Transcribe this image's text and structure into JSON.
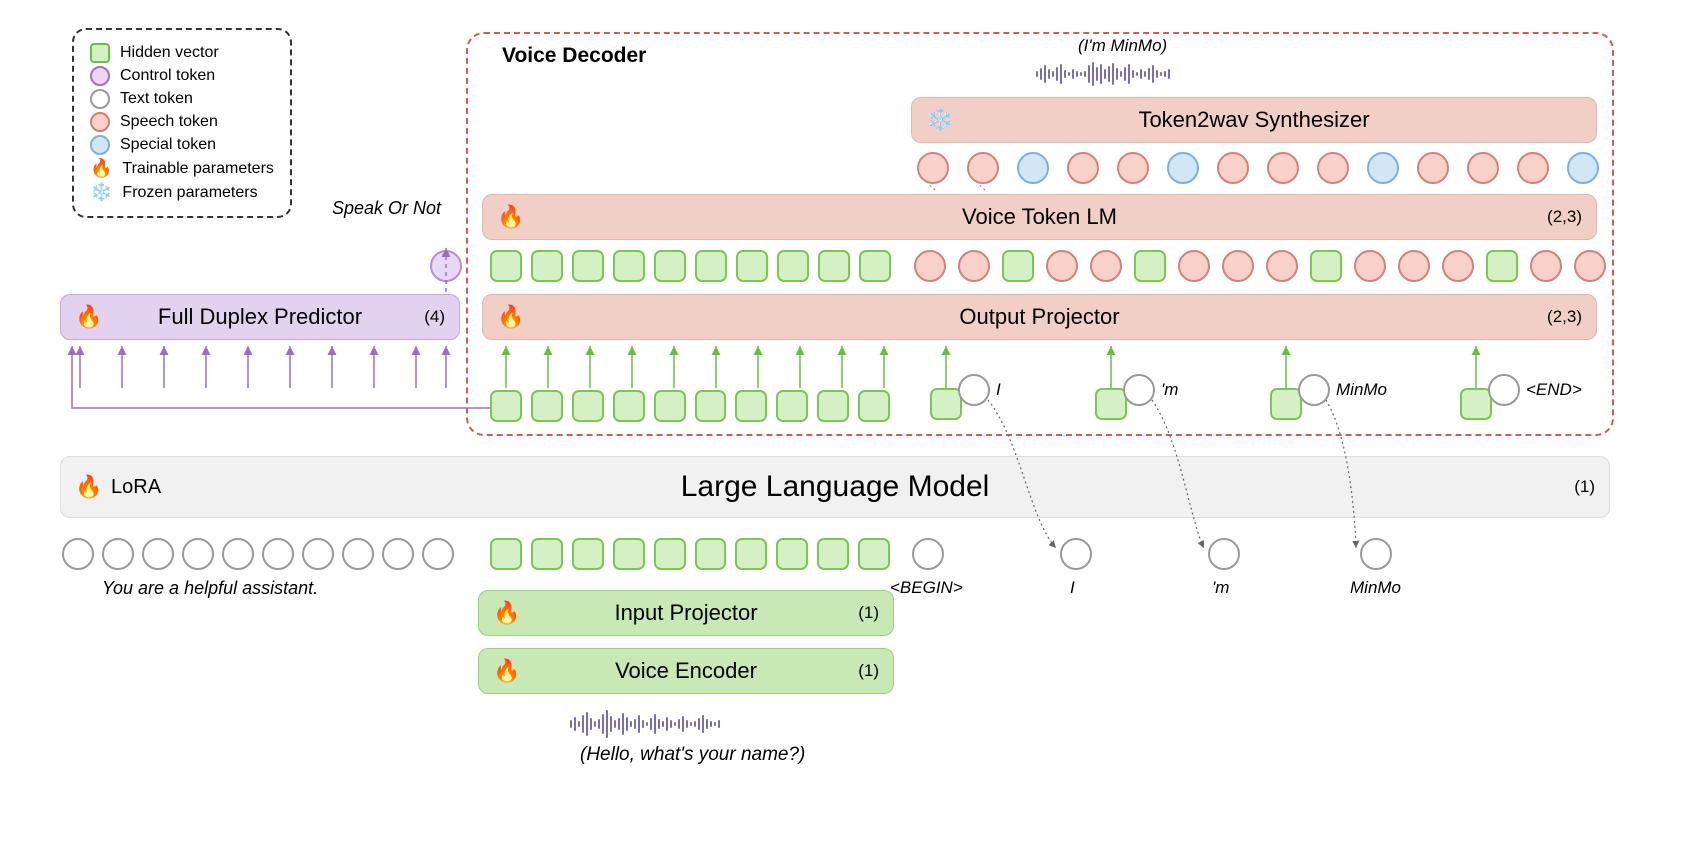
{
  "legend": {
    "hidden": "Hidden vector",
    "control": "Control token",
    "text": "Text token",
    "speech": "Speech token",
    "special": "Special token",
    "trainable": "Trainable parameters",
    "frozen": "Frozen parameters"
  },
  "speak_or_not": "Speak Or Not",
  "vd_title": "Voice Decoder",
  "llm": {
    "label": "Large Language Model",
    "lora": "LoRA",
    "stage": "(1)"
  },
  "input_proj": {
    "label": "Input Projector",
    "stage": "(1)"
  },
  "voice_enc": {
    "label": "Voice Encoder",
    "stage": "(1)"
  },
  "output_proj": {
    "label": "Output Projector",
    "stage": "(2,3)"
  },
  "voice_lm": {
    "label": "Voice Token LM",
    "stage": "(2,3)"
  },
  "token2wav": {
    "label": "Token2wav Synthesizer"
  },
  "fd_pred": {
    "label": "Full Duplex Predictor",
    "stage": "(4)"
  },
  "bottom_caption": "(Hello, what's your name?)",
  "top_caption": "(I'm MinMo)",
  "prompt": "You are a helpful assistant.",
  "tokens": {
    "begin": "<BEGIN>",
    "i": "I",
    "m": "'m",
    "minmo": "MinMo",
    "end": "<END>"
  }
}
